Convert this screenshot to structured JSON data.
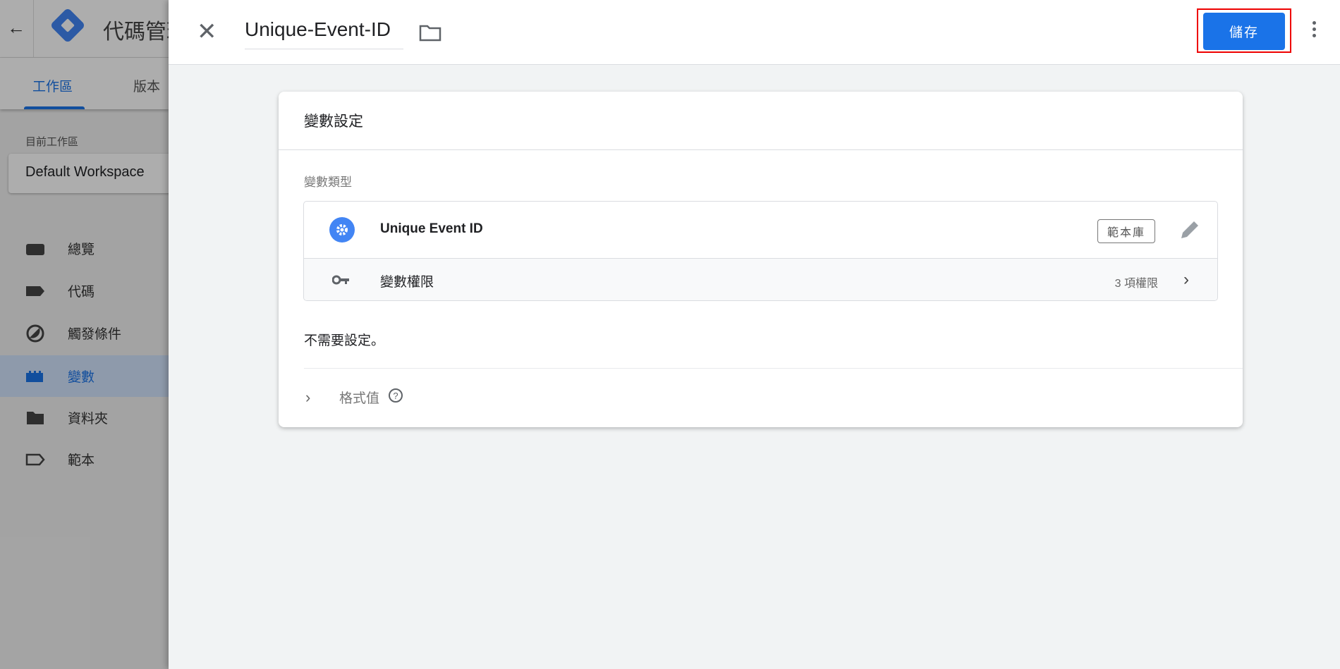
{
  "app": {
    "title": "代碼管理工具",
    "tabs": [
      {
        "label": "工作區",
        "active": true
      },
      {
        "label": "版本",
        "active": false
      }
    ]
  },
  "workspace": {
    "label": "目前工作區",
    "name": "Default Workspace"
  },
  "sidebar": {
    "items": [
      {
        "label": "總覽",
        "icon": "overview-icon",
        "active": false
      },
      {
        "label": "代碼",
        "icon": "tag-icon",
        "active": false
      },
      {
        "label": "觸發條件",
        "icon": "trigger-icon",
        "active": false
      },
      {
        "label": "變數",
        "icon": "variable-icon",
        "active": true
      },
      {
        "label": "資料夾",
        "icon": "folder-icon",
        "active": false
      },
      {
        "label": "範本",
        "icon": "template-icon",
        "active": false
      }
    ]
  },
  "panel": {
    "name": "Unique-Event-ID",
    "save_label": "儲存",
    "card": {
      "title": "變數設定",
      "type_label": "變數類型",
      "type_name": "Unique Event ID",
      "library_badge": "範本庫",
      "permissions_label": "變數權限",
      "permissions_count": "3 項權限",
      "note": "不需要設定。",
      "format_value_label": "格式值"
    }
  },
  "colors": {
    "accent": "#1a73e8",
    "highlight": "#ee0000",
    "gear": "#4285f4"
  }
}
